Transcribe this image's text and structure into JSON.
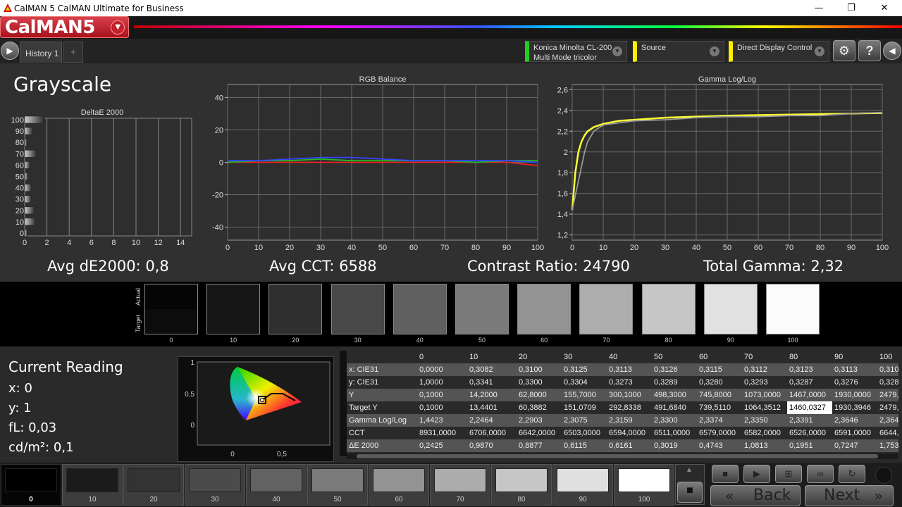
{
  "window": {
    "title": "CalMAN 5 CalMAN Ultimate for Business",
    "minimize": "—",
    "maximize": "❐",
    "close": "✕"
  },
  "brand": {
    "logo": "CalMAN5",
    "logo_dropdown": "▼"
  },
  "tabs": {
    "play": "▶",
    "history_label": "History 1",
    "add": "+"
  },
  "devices": [
    {
      "label1": "Konica Minolta CL-200",
      "label2": "Multi Mode tricolor",
      "color": "#22cc22"
    },
    {
      "label1": "Source",
      "label2": "",
      "color": "#ffee00"
    },
    {
      "label1": "Direct Display Control",
      "label2": "",
      "color": "#ffee00"
    }
  ],
  "toolbar": {
    "settings": "⚙",
    "help": "?",
    "collapse": "◀",
    "dropdown_arrow": "▼"
  },
  "page": {
    "title": "Grayscale"
  },
  "stats": {
    "avg_de": "Avg dE2000: 0,8",
    "avg_cct": "Avg CCT: 6588",
    "contrast": "Contrast Ratio: 24790",
    "gamma": "Total Gamma: 2,32"
  },
  "chart_data": [
    {
      "type": "bar",
      "title": "DeltaE 2000",
      "orientation": "horizontal",
      "categories": [
        "0",
        "10",
        "20",
        "30",
        "40",
        "50",
        "60",
        "70",
        "80",
        "90",
        "100"
      ],
      "values": [
        0.24,
        0.99,
        0.89,
        0.61,
        0.62,
        0.3,
        0.47,
        1.08,
        0.2,
        0.72,
        1.75
      ],
      "xlim": [
        0,
        15
      ],
      "xticks": [
        "0",
        "2",
        "4",
        "6",
        "8",
        "10",
        "12",
        "14"
      ],
      "yticks": [
        "0",
        "10",
        "20",
        "30",
        "40",
        "50",
        "60",
        "70",
        "80",
        "90",
        "100"
      ],
      "grid": true
    },
    {
      "type": "line",
      "title": "RGB Balance",
      "x": [
        0,
        10,
        20,
        30,
        40,
        50,
        60,
        70,
        80,
        90,
        100
      ],
      "series": [
        {
          "color": "#ee2222",
          "values": [
            0,
            0,
            0,
            0,
            0,
            0,
            0,
            0,
            0,
            0,
            -2
          ]
        },
        {
          "color": "#22bb22",
          "values": [
            0,
            1,
            1,
            2,
            1,
            1,
            1,
            1,
            0,
            1,
            1
          ]
        },
        {
          "color": "#3344ff",
          "values": [
            1,
            1,
            2,
            3,
            3,
            2,
            1,
            1,
            1,
            1,
            0
          ]
        }
      ],
      "xlim": [
        0,
        100
      ],
      "ylim": [
        -48,
        48
      ],
      "xticks": [
        "0",
        "10",
        "20",
        "30",
        "40",
        "50",
        "60",
        "70",
        "80",
        "90",
        "100"
      ],
      "yticks": [
        "40",
        "20",
        "0",
        "-20",
        "-40"
      ],
      "grid": true
    },
    {
      "type": "line",
      "title": "Gamma Log/Log",
      "x": [
        0,
        1,
        2,
        3,
        4,
        5,
        7,
        10,
        15,
        20,
        30,
        40,
        50,
        60,
        70,
        80,
        90,
        100
      ],
      "series": [
        {
          "color": "#ffff33",
          "values": [
            1.44,
            1.8,
            2.0,
            2.1,
            2.16,
            2.2,
            2.24,
            2.27,
            2.3,
            2.31,
            2.33,
            2.34,
            2.35,
            2.355,
            2.36,
            2.365,
            2.37,
            2.375
          ]
        },
        {
          "color": "#999999",
          "values": [
            1.44,
            1.58,
            1.72,
            1.86,
            2.0,
            2.1,
            2.2,
            2.26,
            2.28,
            2.3,
            2.31,
            2.33,
            2.34,
            2.34,
            2.35,
            2.35,
            2.37,
            2.38
          ]
        }
      ],
      "xlim": [
        0,
        100
      ],
      "ylim": [
        1.15,
        2.65
      ],
      "xticks": [
        "0",
        "10",
        "20",
        "30",
        "40",
        "50",
        "60",
        "70",
        "80",
        "90",
        "100"
      ],
      "yticks": [
        "2,6",
        "2,4",
        "2,2",
        "2",
        "1,8",
        "1,6",
        "1,4",
        "1,2"
      ],
      "grid": true
    }
  ],
  "swatches": {
    "actual_label": "Actual",
    "target_label": "Target",
    "items": [
      {
        "label": "0",
        "actual": "#050505",
        "target": "#0c0c0c"
      },
      {
        "label": "10",
        "actual": "#161616",
        "target": "#161616"
      },
      {
        "label": "20",
        "actual": "#2e2e2e",
        "target": "#2f2f2f"
      },
      {
        "label": "30",
        "actual": "#484848",
        "target": "#484848"
      },
      {
        "label": "40",
        "actual": "#606060",
        "target": "#606060"
      },
      {
        "label": "50",
        "actual": "#7a7a7a",
        "target": "#7a7a7a"
      },
      {
        "label": "60",
        "actual": "#939393",
        "target": "#939393"
      },
      {
        "label": "70",
        "actual": "#adadad",
        "target": "#adadad"
      },
      {
        "label": "80",
        "actual": "#c6c6c6",
        "target": "#c6c6c6"
      },
      {
        "label": "90",
        "actual": "#e1e1e1",
        "target": "#e1e1e1"
      },
      {
        "label": "100",
        "actual": "#fbfbfb",
        "target": "#fbfbfb"
      }
    ]
  },
  "reading": {
    "title": "Current Reading",
    "x": "x: 0",
    "y": "y: 1",
    "fl": "fL: 0,03",
    "cdm2": "cd/m²: 0,1"
  },
  "cie_axes": {
    "y1": "1",
    "y05": "0,5",
    "y0": "0",
    "x0": "0",
    "x05": "0,5"
  },
  "table": {
    "columns": [
      "",
      "0",
      "10",
      "20",
      "30",
      "40",
      "50",
      "60",
      "70",
      "80",
      "90",
      "100"
    ],
    "rows": [
      [
        "x: CIE31",
        "0,0000",
        "0,3082",
        "0,3100",
        "0,3125",
        "0,3113",
        "0,3126",
        "0,3115",
        "0,3112",
        "0,3123",
        "0,3113",
        "0,310"
      ],
      [
        "y: CIE31",
        "1,0000",
        "0,3341",
        "0,3300",
        "0,3304",
        "0,3273",
        "0,3289",
        "0,3280",
        "0,3293",
        "0,3287",
        "0,3276",
        "0,328"
      ],
      [
        "Y",
        "0,1000",
        "14,2000",
        "62,8000",
        "155,7000",
        "300,1000",
        "498,3000",
        "745,8000",
        "1073,0000",
        "1467,0000",
        "1930,0000",
        "2479,"
      ],
      [
        "Target Y",
        "0,1000",
        "13,4401",
        "60,3882",
        "151,0709",
        "292,8338",
        "491,6840",
        "739,5110",
        "1064,3512",
        "1460,0327",
        "1930,3946",
        "2479,"
      ],
      [
        "Gamma Log/Log",
        "1,4423",
        "2,2464",
        "2,2903",
        "2,3075",
        "2,3159",
        "2,3300",
        "2,3374",
        "2,3350",
        "2,3391",
        "2,3646",
        "2,364"
      ],
      [
        "CCT",
        "8931,0000",
        "6706,0000",
        "6642,0000",
        "6503,0000",
        "6594,0000",
        "6511,0000",
        "6579,0000",
        "6582,0000",
        "6526,0000",
        "6591,0000",
        "6644,"
      ],
      [
        "ΔE 2000",
        "0,2425",
        "0,9870",
        "0,8877",
        "0,6115",
        "0,6161",
        "0,3019",
        "0,4743",
        "1,0813",
        "0,1951",
        "0,7247",
        "1,753"
      ]
    ]
  },
  "bottom": {
    "swatches": [
      {
        "label": "0",
        "color": "#000000"
      },
      {
        "label": "10",
        "color": "#1b1b1b"
      },
      {
        "label": "20",
        "color": "#333333"
      },
      {
        "label": "30",
        "color": "#4b4b4b"
      },
      {
        "label": "40",
        "color": "#626262"
      },
      {
        "label": "50",
        "color": "#7b7b7b"
      },
      {
        "label": "60",
        "color": "#939393"
      },
      {
        "label": "70",
        "color": "#acacac"
      },
      {
        "label": "80",
        "color": "#c6c6c6"
      },
      {
        "label": "90",
        "color": "#e0e0e0"
      },
      {
        "label": "100",
        "color": "#ffffff"
      }
    ],
    "controls": {
      "up": "▲",
      "stop_square": "■",
      "stop": "■",
      "play": "▶",
      "step": "⊞",
      "loop": "∞",
      "refresh": "↻"
    },
    "back_label": "Back",
    "next_label": "Next",
    "back_arrow": "«",
    "next_arrow": "»"
  }
}
